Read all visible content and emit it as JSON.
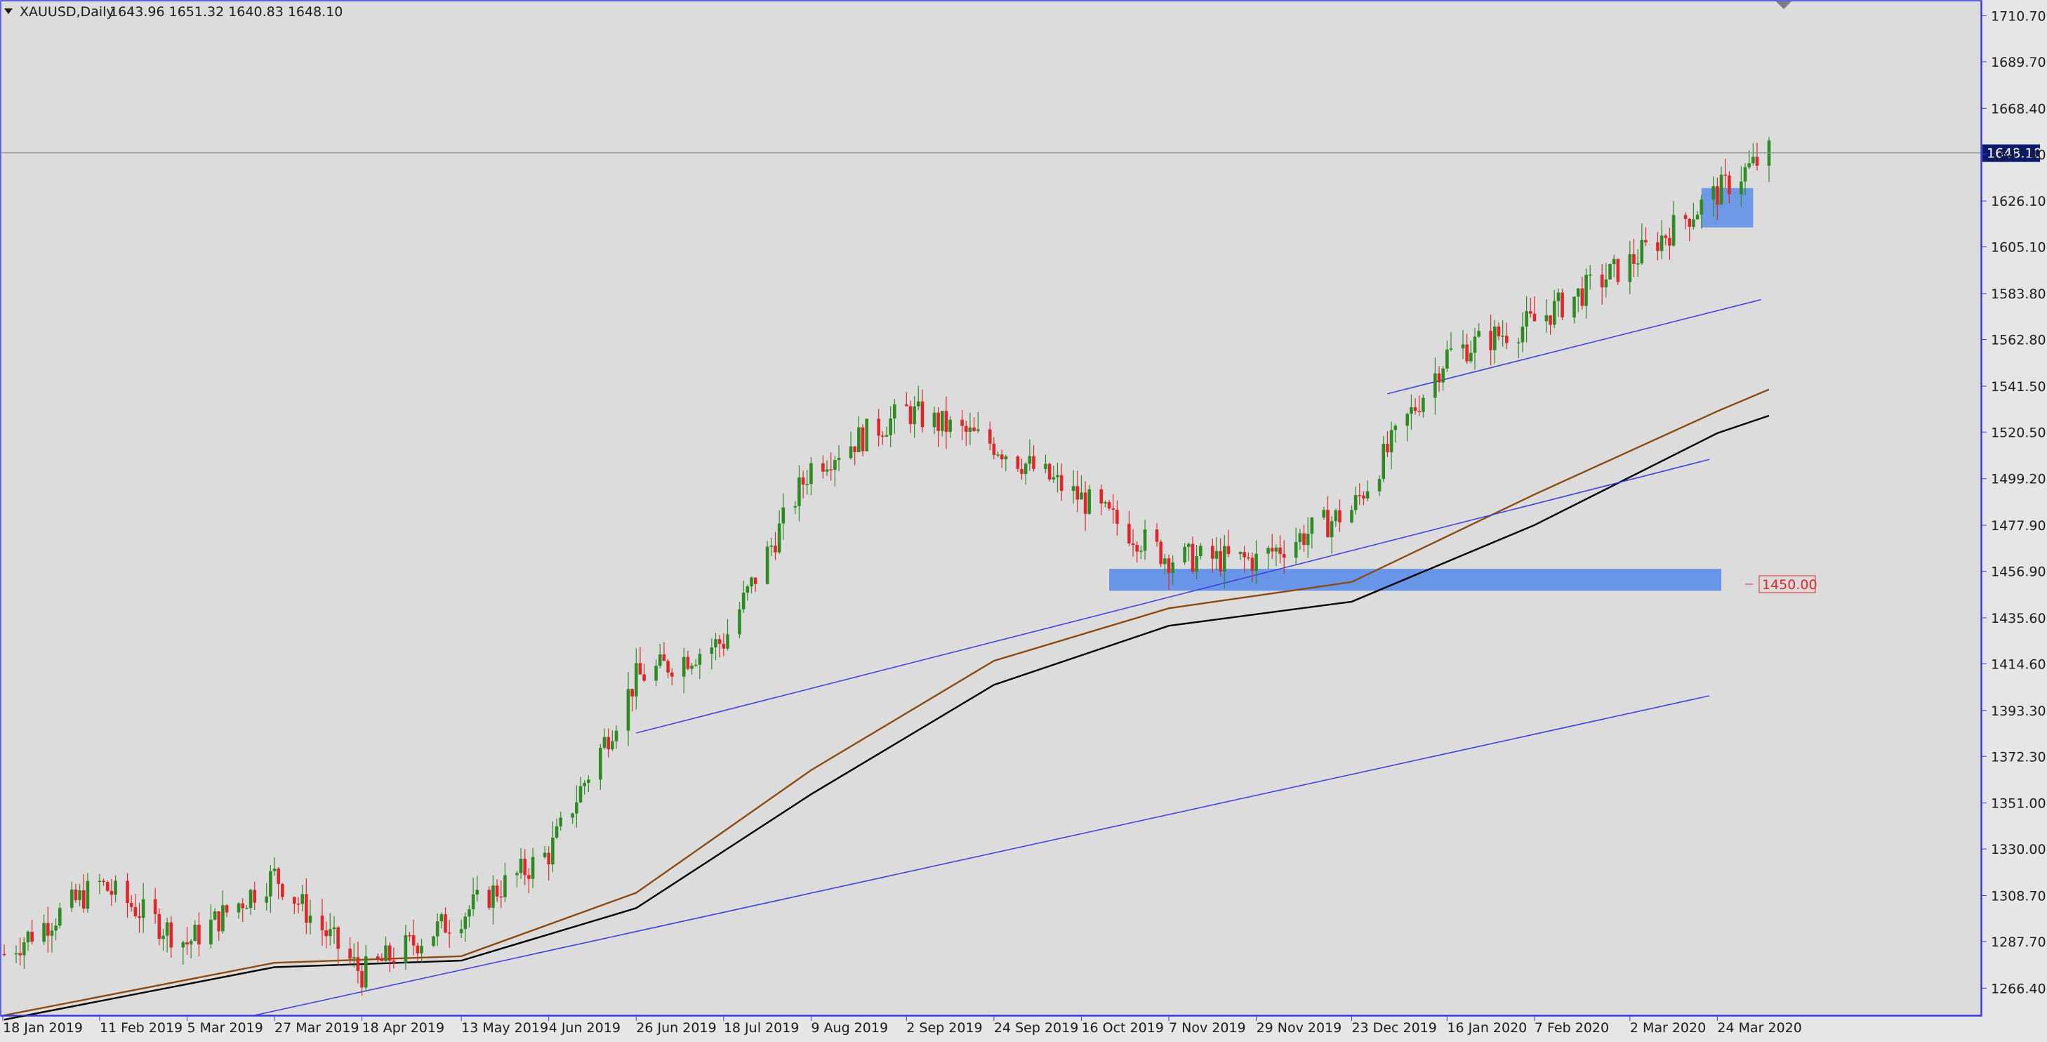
{
  "header": {
    "symbol": "XAUUSD,Daily",
    "ohlc": "1643.96 1651.32 1640.83 1648.10"
  },
  "colors": {
    "background": "#dcdcdc",
    "axis_text": "#1c1c1c",
    "bull_candle": "#2e8b23",
    "bear_candle": "#e0262a",
    "ma_fast": "#8b4a12",
    "ma_slow": "#000000",
    "trendline": "#3b3bd9",
    "zone": "#5b8de8",
    "price_tag_bg": "#0a1a6e",
    "level_label": "#e0262a"
  },
  "chart_data": {
    "type": "candlestick",
    "title": "XAUUSD,Daily",
    "ylim": [
      1254,
      1716
    ],
    "y_ticks": [
      1266.4,
      1287.7,
      1308.7,
      1330.0,
      1351.0,
      1372.3,
      1393.3,
      1414.6,
      1435.6,
      1456.9,
      1477.9,
      1499.2,
      1520.5,
      1541.5,
      1562.8,
      1583.8,
      1605.1,
      1626.1,
      1647.4,
      1668.4,
      1689.7,
      1710.7
    ],
    "x_ticks": [
      "18 Jan 2019",
      "11 Feb 2019",
      "5 Mar 2019",
      "27 Mar 2019",
      "18 Apr 2019",
      "13 May 2019",
      "4 Jun 2019",
      "26 Jun 2019",
      "18 Jul 2019",
      "9 Aug 2019",
      "2 Sep 2019",
      "24 Sep 2019",
      "16 Oct 2019",
      "7 Nov 2019",
      "29 Nov 2019",
      "23 Dec 2019",
      "16 Jan 2020",
      "7 Feb 2020",
      "2 Mar 2020",
      "24 Mar 2020"
    ],
    "last_price": "1648.10",
    "level_label": "1450.00",
    "series": [
      {
        "kind": "close",
        "x": [
          "2019-01-18",
          "2019-02-11",
          "2019-03-05",
          "2019-03-27",
          "2019-04-18",
          "2019-05-13",
          "2019-06-04",
          "2019-06-26",
          "2019-07-18",
          "2019-08-09",
          "2019-09-02",
          "2019-09-24",
          "2019-10-16",
          "2019-11-07",
          "2019-11-29",
          "2019-12-23",
          "2020-01-16",
          "2020-02-07",
          "2020-03-02",
          "2020-03-24",
          "2020-04-06"
        ],
        "values": [
          1282,
          1314,
          1287,
          1318,
          1273,
          1300,
          1328,
          1408,
          1425,
          1505,
          1530,
          1515,
          1490,
          1463,
          1462,
          1485,
          1556,
          1571,
          1598,
          1630,
          1648
        ]
      },
      {
        "kind": "moving-average",
        "x": [
          "2019-01-18",
          "2019-03-27",
          "2019-05-13",
          "2019-06-26",
          "2019-08-09",
          "2019-09-24",
          "2019-11-07",
          "2019-12-23",
          "2020-02-07",
          "2020-03-24",
          "2020-04-06"
        ],
        "values": [
          1254,
          1278,
          1281,
          1310,
          1366,
          1416,
          1440,
          1452,
          1492,
          1530,
          1540
        ]
      },
      {
        "kind": "moving-average",
        "x": [
          "2019-01-18",
          "2019-03-27",
          "2019-05-13",
          "2019-06-26",
          "2019-08-09",
          "2019-09-24",
          "2019-11-07",
          "2019-12-23",
          "2020-02-07",
          "2020-03-24",
          "2020-04-06"
        ],
        "values": [
          1252,
          1276,
          1279,
          1303,
          1355,
          1405,
          1432,
          1443,
          1478,
          1520,
          1528
        ]
      }
    ]
  }
}
